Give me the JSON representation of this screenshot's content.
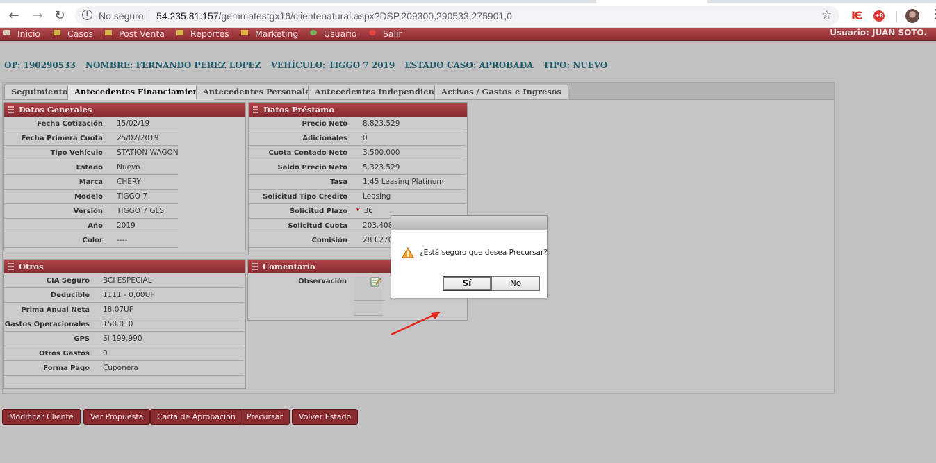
{
  "browser": {
    "insecure_label": "No seguro",
    "url_host": "54.235.81.157",
    "url_path": "/gemmatestgx16/clientenatural.aspx?DSP,209300,290533,275901,0",
    "ext_badge": "+8"
  },
  "menu": {
    "items": [
      {
        "label": "Inicio",
        "icon": "home-icon"
      },
      {
        "label": "Casos",
        "icon": "folder-icon"
      },
      {
        "label": "Post Venta",
        "icon": "folder-icon"
      },
      {
        "label": "Reportes",
        "icon": "folder-icon"
      },
      {
        "label": "Marketing",
        "icon": "folder-icon"
      },
      {
        "label": "Usuario",
        "icon": "user-icon"
      },
      {
        "label": "Salir",
        "icon": "exit-icon"
      }
    ],
    "user_label": "Usuario:  JUAN SOTO."
  },
  "summary": {
    "op": "OP: 190290533",
    "nombre": "NOMBRE: FERNANDO PEREZ LOPEZ",
    "vehiculo": "VEHÍCULO: TIGGO 7 2019",
    "estado": "ESTADO CASO: APROBADA",
    "tipo": "TIPO: NUEVO"
  },
  "tabs": [
    {
      "label": "Seguimiento",
      "active": false
    },
    {
      "label": "Antecedentes Financiamiento",
      "active": true
    },
    {
      "label": "Antecedentes Personales",
      "active": false
    },
    {
      "label": "Antecedentes Independiente",
      "active": false
    },
    {
      "label": "Activos / Gastos e Ingresos",
      "active": false
    }
  ],
  "datos_generales": {
    "title": "Datos Generales",
    "rows": [
      {
        "label": "Fecha Cotización",
        "value": "15/02/19"
      },
      {
        "label": "Fecha Primera Cuota",
        "value": "25/02/2019"
      },
      {
        "label": "Tipo Vehículo",
        "value": "STATION WAGON"
      },
      {
        "label": "Estado",
        "value": "Nuevo"
      },
      {
        "label": "Marca",
        "value": "CHERY"
      },
      {
        "label": "Modelo",
        "value": "TIGGO 7"
      },
      {
        "label": "Versión",
        "value": "TIGGO 7 GLS"
      },
      {
        "label": "Año",
        "value": "2019"
      },
      {
        "label": "Color",
        "value": "----"
      }
    ]
  },
  "datos_prestamo": {
    "title": "Datos Préstamo",
    "rows": [
      {
        "label": "Precio Neto",
        "value": "8.823.529"
      },
      {
        "label": "Adicionales",
        "value": "0"
      },
      {
        "label": "Cuota Contado Neto",
        "value": "3.500.000"
      },
      {
        "label": "Saldo Precio Neto",
        "value": "5.323.529"
      },
      {
        "label": "Tasa",
        "value": "1,45  Leasing Platinum"
      },
      {
        "label": "Solicitud Tipo Credito",
        "value": "Leasing"
      },
      {
        "label": "Solicitud Plazo",
        "value": "36",
        "required": "*"
      },
      {
        "label": "Solicitud Cuota",
        "value": "203.408"
      },
      {
        "label": "Comisión",
        "value": "283.270"
      }
    ]
  },
  "otros": {
    "title": "Otros",
    "rows": [
      {
        "label": "CIA Seguro",
        "value": "BCI ESPECIAL"
      },
      {
        "label": "Deducible",
        "value": "1111 -  0,00UF"
      },
      {
        "label": "Prima Anual Neta",
        "value": "18,07UF"
      },
      {
        "label": "Gastos Operacionales",
        "value": "150.010"
      },
      {
        "label": "GPS",
        "value": "SI 199.990"
      },
      {
        "label": "Otros Gastos",
        "value": "0"
      },
      {
        "label": "Forma Pago",
        "value": "Cuponera"
      }
    ]
  },
  "comentario": {
    "title": "Comentario",
    "label": "Observación"
  },
  "actions": [
    {
      "label": "Modificar Cliente"
    },
    {
      "label": "Ver Propuesta"
    },
    {
      "label": "Carta de Aprobación"
    },
    {
      "label": "Precursar"
    },
    {
      "label": "Volver Estado"
    }
  ],
  "dialog": {
    "message": "¿Está seguro que desea Precursar?",
    "yes": "Sí",
    "no": "No"
  },
  "colors": {
    "header_red": "#8e2b31",
    "summary_teal": "#1d5a6a",
    "app_bg": "#c1c1c1"
  }
}
